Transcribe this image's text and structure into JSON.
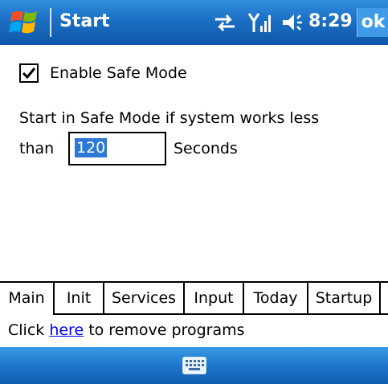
{
  "title_bar": {
    "title": "Start",
    "time": "8:29",
    "ok_label": "ok",
    "icons": {
      "start": "windows-flag-icon",
      "connectivity": "sync-arrows-icon",
      "signal": "signal-strength-icon",
      "volume": "speaker-icon"
    }
  },
  "settings": {
    "enable_safe_mode": {
      "label": "Enable Safe Mode",
      "checked": true
    },
    "description": "Start in Safe Mode if system works less",
    "than_label": "than",
    "seconds_value": "120",
    "seconds_label": "Seconds"
  },
  "tabs": [
    {
      "label": "Main",
      "active": true
    },
    {
      "label": "Init",
      "active": false
    },
    {
      "label": "Services",
      "active": false
    },
    {
      "label": "Input",
      "active": false
    },
    {
      "label": "Today",
      "active": false
    },
    {
      "label": "Startup",
      "active": false
    }
  ],
  "footer": {
    "prefix": "Click ",
    "link_text": "here",
    "suffix": " to remove programs"
  },
  "menu_bar": {
    "sip_icon": "keyboard-icon"
  },
  "colors": {
    "title_bar": "#1c6fc4",
    "selection": "#2b78d6",
    "link": "#0000ee"
  }
}
